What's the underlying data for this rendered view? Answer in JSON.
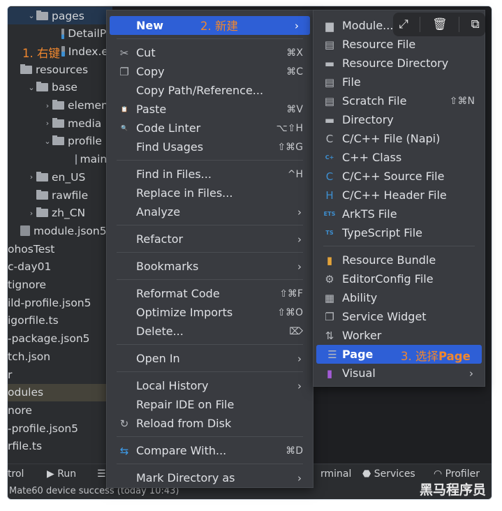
{
  "tree": [
    {
      "label": "pages",
      "chev": "⌄",
      "indent": 1,
      "type": "folder",
      "state": "selected"
    },
    {
      "label": "DetailPa",
      "indent": 3,
      "type": "ets"
    },
    {
      "label": "Index.et",
      "indent": 3,
      "type": "ets"
    },
    {
      "label": "resources",
      "indent": 0,
      "type": "folder"
    },
    {
      "label": "base",
      "chev": "⌄",
      "indent": 1,
      "type": "folder"
    },
    {
      "label": "element",
      "chev": "›",
      "indent": 2,
      "type": "folder"
    },
    {
      "label": "media",
      "chev": "›",
      "indent": 2,
      "type": "folder"
    },
    {
      "label": "profile",
      "chev": "⌄",
      "indent": 2,
      "type": "folder"
    },
    {
      "label": "main_",
      "indent": 4,
      "type": "json"
    },
    {
      "label": "en_US",
      "chev": "›",
      "indent": 1,
      "type": "folder"
    },
    {
      "label": "rawfile",
      "indent": 1,
      "type": "folder"
    },
    {
      "label": "zh_CN",
      "chev": "›",
      "indent": 1,
      "type": "folder"
    },
    {
      "label": "module.json5",
      "indent": 0,
      "type": "json"
    },
    {
      "label": "ohosTest",
      "indent": -1,
      "type": "none"
    },
    {
      "label": "c-day01",
      "indent": -1,
      "type": "none"
    },
    {
      "label": "tignore",
      "indent": -1,
      "type": "none"
    },
    {
      "label": "ild-profile.json5",
      "indent": -1,
      "type": "none"
    },
    {
      "label": "igorfile.ts",
      "indent": -1,
      "type": "none"
    },
    {
      "label": "-package.json5",
      "indent": -1,
      "type": "none"
    },
    {
      "label": "tch.json",
      "indent": -1,
      "type": "none"
    },
    {
      "label": "r",
      "indent": -1,
      "type": "none"
    },
    {
      "label": "odules",
      "indent": -1,
      "type": "none",
      "state": "highlight"
    },
    {
      "label": "nore",
      "indent": -1,
      "type": "none"
    },
    {
      "label": "-profile.json5",
      "indent": -1,
      "type": "none"
    },
    {
      "label": "rfile.ts",
      "indent": -1,
      "type": "none"
    }
  ],
  "menu": [
    {
      "label": "New",
      "arrow": true,
      "active": true
    },
    {
      "sep": true
    },
    {
      "label": "Cut",
      "icon": "scissors-icon",
      "glyph": "✂",
      "shortcut": "⌘X"
    },
    {
      "label": "Copy",
      "icon": "copy-icon",
      "glyph": "❐",
      "shortcut": "⌘C"
    },
    {
      "label": "Copy Path/Reference..."
    },
    {
      "label": "Paste",
      "icon": "clipboard-icon",
      "glyph": "📋",
      "shortcut": "⌘V"
    },
    {
      "label": "Code Linter",
      "icon": "linter-icon",
      "glyph": "🔍",
      "shortcut": "⌥⇧H"
    },
    {
      "label": "Find Usages",
      "shortcut": "⇧⌘G"
    },
    {
      "sep": true
    },
    {
      "label": "Find in Files...",
      "shortcut": "^H"
    },
    {
      "label": "Replace in Files..."
    },
    {
      "label": "Analyze",
      "arrow": true
    },
    {
      "sep": true
    },
    {
      "label": "Refactor",
      "arrow": true
    },
    {
      "sep": true
    },
    {
      "label": "Bookmarks",
      "arrow": true
    },
    {
      "sep": true
    },
    {
      "label": "Reformat Code",
      "shortcut": "⇧⌘F"
    },
    {
      "label": "Optimize Imports",
      "shortcut": "⇧⌘O"
    },
    {
      "label": "Delete...",
      "shortcut": "⌦"
    },
    {
      "sep": true
    },
    {
      "label": "Open In",
      "arrow": true
    },
    {
      "sep": true
    },
    {
      "label": "Local History",
      "arrow": true
    },
    {
      "label": "Repair IDE on File"
    },
    {
      "label": "Reload from Disk",
      "icon": "reload-icon",
      "glyph": "↻"
    },
    {
      "sep": true
    },
    {
      "label": "Compare With...",
      "icon": "compare-icon",
      "glyph": "⇆",
      "shortcut": "⌘D",
      "color": "#3d9be9"
    },
    {
      "sep": true
    },
    {
      "label": "Mark Directory as",
      "arrow": true
    }
  ],
  "submenu": [
    {
      "label": "Module...",
      "icon": "module-icon",
      "glyph": "▆"
    },
    {
      "label": "Resource File",
      "icon": "resource-file-icon",
      "glyph": "▤"
    },
    {
      "label": "Resource Directory",
      "icon": "folder-icon",
      "glyph": "▬"
    },
    {
      "label": "File",
      "icon": "file-icon",
      "glyph": "▤"
    },
    {
      "label": "Scratch File",
      "icon": "scratch-file-icon",
      "glyph": "▤",
      "shortcut": "⇧⌘N"
    },
    {
      "label": "Directory",
      "icon": "folder-icon",
      "glyph": "▬"
    },
    {
      "label": "C/C++ File (Napi)",
      "icon": "c-file-icon",
      "glyph": "C"
    },
    {
      "label": "C++ Class",
      "icon": "cpp-class-icon",
      "glyph": "C+",
      "color": "#3d8fd1"
    },
    {
      "label": "C/C++ Source File",
      "icon": "c-source-icon",
      "glyph": "C",
      "color": "#3d8fd1"
    },
    {
      "label": "C/C++ Header File",
      "icon": "c-header-icon",
      "glyph": "H",
      "color": "#3d8fd1"
    },
    {
      "label": "ArkTS File",
      "icon": "arkts-file-icon",
      "glyph": "ETS",
      "color": "#3d8fd1"
    },
    {
      "label": "TypeScript File",
      "icon": "typescript-file-icon",
      "glyph": "TS",
      "color": "#3d8fd1"
    },
    {
      "sep": true
    },
    {
      "label": "Resource Bundle",
      "icon": "resource-bundle-icon",
      "glyph": "▮",
      "color": "#e3a33a"
    },
    {
      "label": "EditorConfig File",
      "icon": "gear-icon",
      "glyph": "⚙"
    },
    {
      "label": "Ability",
      "icon": "ability-icon",
      "glyph": "▦"
    },
    {
      "label": "Service Widget",
      "icon": "widget-icon",
      "glyph": "❐"
    },
    {
      "label": "Worker",
      "icon": "worker-icon",
      "glyph": "⇅"
    },
    {
      "label": "Page",
      "icon": "list-icon",
      "glyph": "☰",
      "active": true
    },
    {
      "label": "Visual",
      "icon": "visual-icon",
      "glyph": "▮",
      "color": "#a35bd6",
      "arrow": true
    }
  ],
  "annotations": {
    "step1": "1. 右键",
    "step2": "2. 新建",
    "step3_prefix": "3. 选择",
    "step3_bold": "Page"
  },
  "bottombar": {
    "control": "trol",
    "run": "Run",
    "terminal": "rminal",
    "services": "Services",
    "profiler": "Profiler"
  },
  "status": "Mate60 device success (today 10:43)",
  "watermark": "黑马程序员",
  "colors": {
    "accent": "#2e5fd6",
    "annotation": "#f0872e",
    "menu_bg": "#393b40"
  }
}
